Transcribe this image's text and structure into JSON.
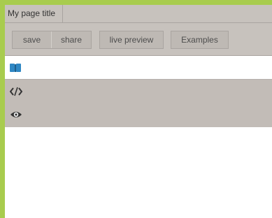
{
  "window": {
    "title": "My page title"
  },
  "toolbar": {
    "save_label": "save",
    "share_label": "share",
    "live_preview_label": "live preview",
    "examples_label": "Examples"
  },
  "panels": [
    {
      "icon": "book-icon",
      "color": "#2f87c4"
    },
    {
      "icon": "code-icon",
      "color": "#333333"
    },
    {
      "icon": "eye-icon",
      "color": "#333333"
    }
  ],
  "colors": {
    "frame": "#a8cc4e",
    "toolbar_bg": "#c7c2bd",
    "row_grey": "#c2bcb7",
    "accent": "#2f87c4"
  }
}
